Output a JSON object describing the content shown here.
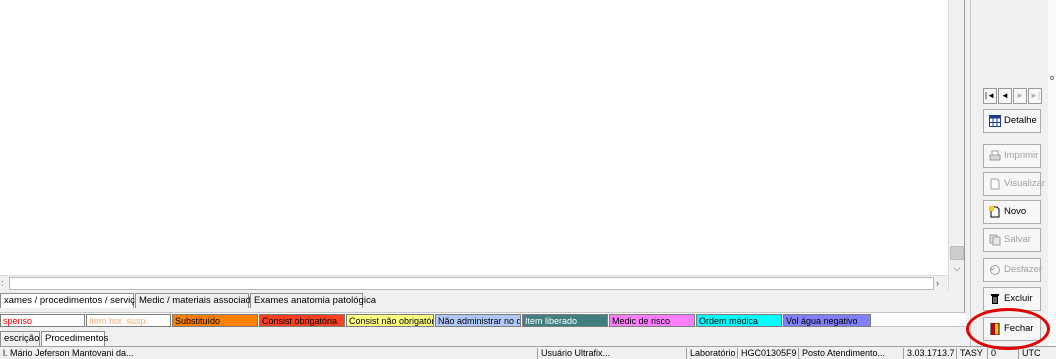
{
  "tabs_top": [
    {
      "label": "xames / procedimentos / serviços"
    },
    {
      "label": "Medic / materiais associados"
    },
    {
      "label": "Exames anatomia patológica"
    }
  ],
  "legend": [
    {
      "label": "spenso",
      "bg": "#ffffff",
      "color": "#ff0000"
    },
    {
      "label": "Item hor. susp.",
      "bg": "#ffffff",
      "color": "#f0b070"
    },
    {
      "label": "Substituído",
      "bg": "#ff8000",
      "color": "#000000"
    },
    {
      "label": "Consist obrigatória",
      "bg": "#ff4020",
      "color": "#000000"
    },
    {
      "label": "Consist não obrigatória",
      "bg": "#ffff80",
      "color": "#000000"
    },
    {
      "label": "Não administrar no dia",
      "bg": "#b0c8ff",
      "color": "#000000"
    },
    {
      "label": "Item liberado",
      "bg": "#3f7f7f",
      "color": "#ffffff"
    },
    {
      "label": "Medic de risco",
      "bg": "#ff80ff",
      "color": "#000000"
    },
    {
      "label": "Ordem médica",
      "bg": "#00ffff",
      "color": "#000000"
    },
    {
      "label": "Vol água negativo",
      "bg": "#8080ff",
      "color": "#000000"
    }
  ],
  "tabs_bottom": [
    {
      "label": "escrição"
    },
    {
      "label": "Procedimentos"
    }
  ],
  "status": [
    "l. Mário Jeferson Mantovani da...",
    "Usuário Ultrafix...",
    "Laboratório",
    "HGC01305F9",
    "Posto Atendimento...",
    "3.03.1713.7",
    "TASY",
    "0",
    "UTC"
  ],
  "nav": [
    "|◄",
    "◄",
    "►",
    "►|"
  ],
  "buttons": {
    "detalhe": "Detalhe",
    "imprimir": "Imprimir",
    "visualizar": "Visualizar",
    "novo": "Novo",
    "salvar": "Salvar",
    "desfazer": "Desfazer",
    "excluir": "Excluir",
    "fechar": "Fechar"
  }
}
